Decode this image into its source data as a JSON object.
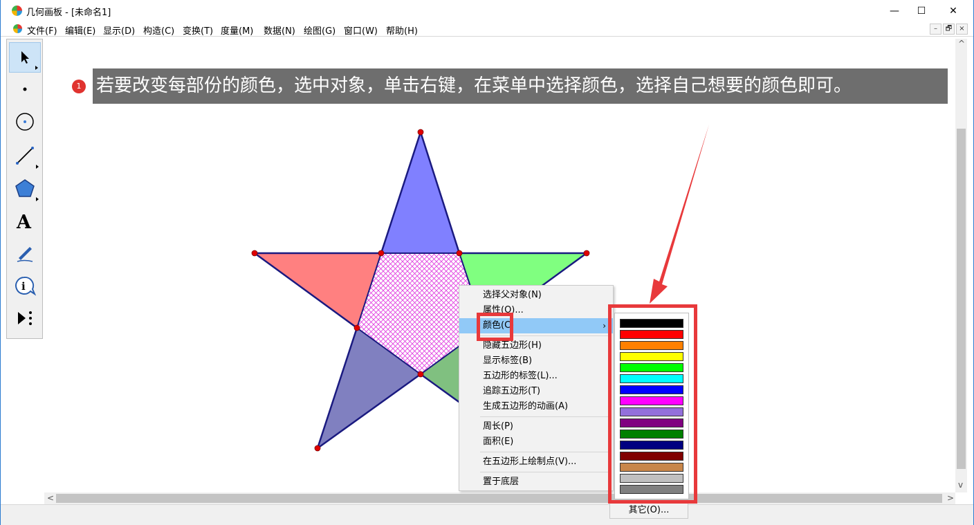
{
  "window": {
    "title": "几何画板 - [未命名1]",
    "controls": {
      "minimize": "—",
      "maximize": "☐",
      "close": "✕"
    }
  },
  "menubar": {
    "items": [
      "文件(F)",
      "编辑(E)",
      "显示(D)",
      "构造(C)",
      "变换(T)",
      "度量(M)",
      "数据(N)",
      "绘图(G)",
      "窗口(W)",
      "帮助(H)"
    ],
    "mdi_controls": [
      "–",
      "🗗",
      "×"
    ]
  },
  "toolbox": {
    "tools": [
      "arrow-select-tool",
      "point-tool",
      "compass-tool",
      "straightedge-tool",
      "polygon-tool",
      "text-tool",
      "marker-tool",
      "information-tool",
      "custom-tool"
    ]
  },
  "callout": {
    "number": "1",
    "text": "若要改变每部份的颜色，选中对象，单击右键，在菜单中选择颜色，选择自己想要的颜色即可。"
  },
  "context_menu": {
    "items": [
      "选择父对象(N)",
      "属性(O)...",
      "颜色(C)",
      "隐藏五边形(H)",
      "显示标签(B)",
      "五边形的标签(L)...",
      "追踪五边形(T)",
      "生成五边形的动画(A)",
      "周长(P)",
      "面积(E)",
      "在五边形上绘制点(V)...",
      "置于底层"
    ],
    "highlighted": "颜色(C)",
    "submenu_arrow": "›"
  },
  "color_palette": {
    "swatches": [
      "#000000",
      "#ff0000",
      "#ff8000",
      "#ffff00",
      "#00ff00",
      "#00ffff",
      "#0000ff",
      "#ff00ff",
      "#9370db",
      "#800080",
      "#008000",
      "#000080",
      "#800000",
      "#c8864a",
      "#c0c0c0",
      "#808080"
    ],
    "other_label": "其它(O)..."
  },
  "scroll_arrows": {
    "up": "^",
    "down": "v",
    "left": "<",
    "right": ">"
  },
  "colors": {
    "annotation_red": "#e8393b",
    "menu_highlight": "#91c9f7",
    "star_top": "#8080ff",
    "star_left": "#ff8080",
    "star_right": "#80ff80",
    "star_bottom_left": "#8080c0",
    "star_bottom_right": "#80c080",
    "center_hatch": "#e040e0",
    "outline": "#1a1a80",
    "vertex": "#e00000"
  }
}
